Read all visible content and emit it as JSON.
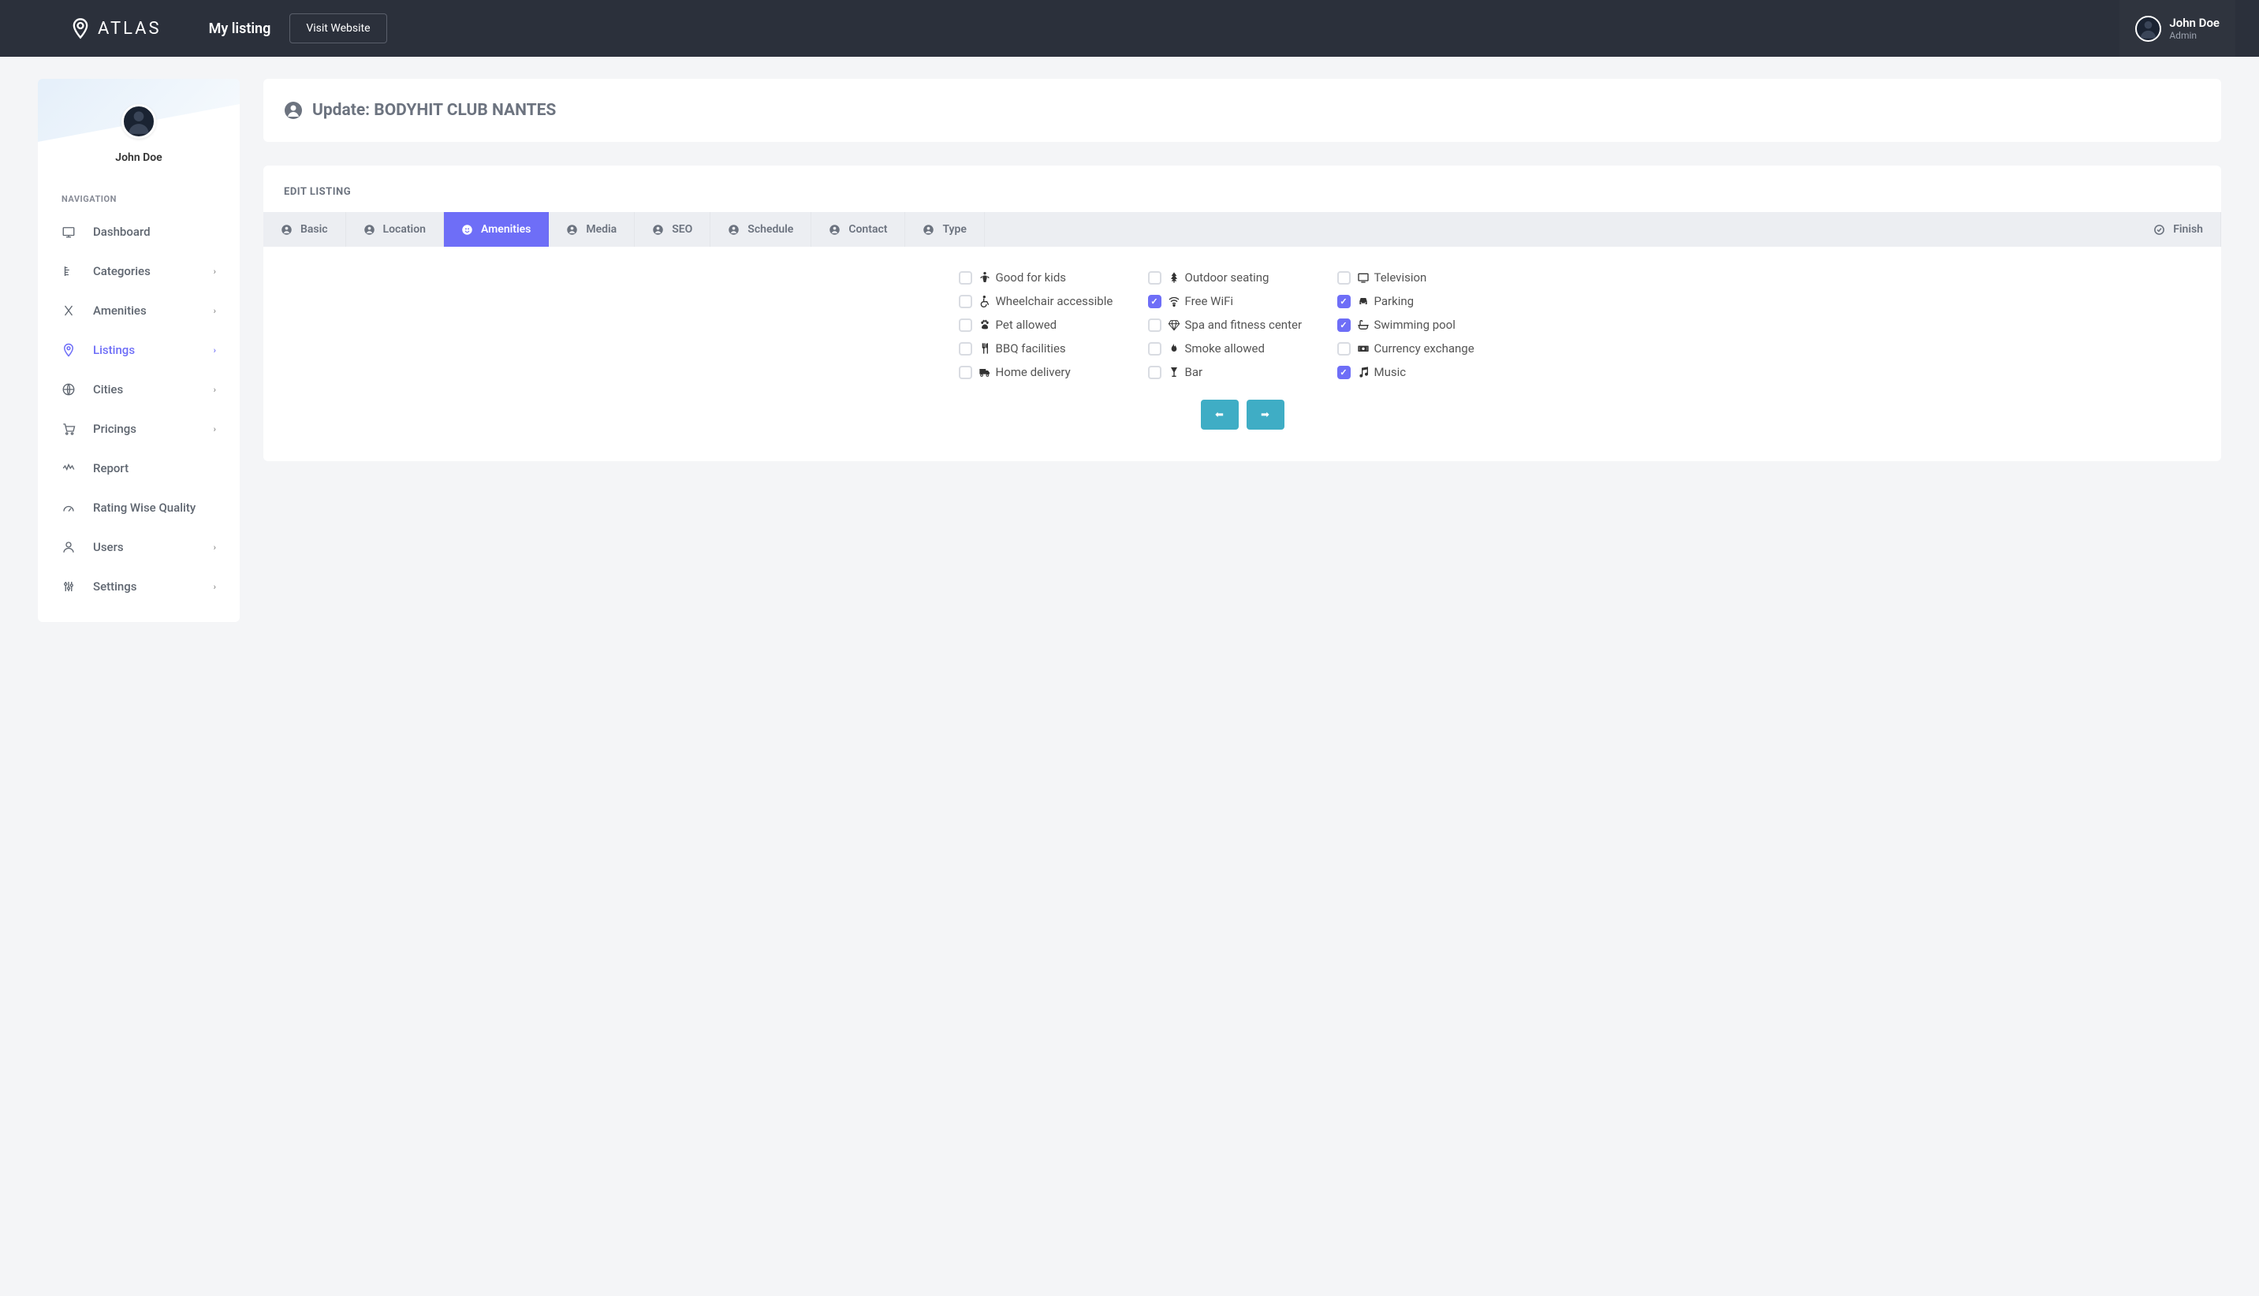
{
  "header": {
    "logo_text": "ATLAS",
    "page_title": "My listing",
    "visit_button": "Visit Website",
    "user_name": "John Doe",
    "user_role": "Admin"
  },
  "sidebar": {
    "user_name": "John Doe",
    "nav_heading": "NAVIGATION",
    "items": [
      {
        "label": "Dashboard",
        "has_children": false,
        "active": false
      },
      {
        "label": "Categories",
        "has_children": true,
        "active": false
      },
      {
        "label": "Amenities",
        "has_children": true,
        "active": false
      },
      {
        "label": "Listings",
        "has_children": true,
        "active": true
      },
      {
        "label": "Cities",
        "has_children": true,
        "active": false
      },
      {
        "label": "Pricings",
        "has_children": true,
        "active": false
      },
      {
        "label": "Report",
        "has_children": false,
        "active": false
      },
      {
        "label": "Rating Wise Quality",
        "has_children": false,
        "active": false
      },
      {
        "label": "Users",
        "has_children": true,
        "active": false
      },
      {
        "label": "Settings",
        "has_children": true,
        "active": false
      }
    ]
  },
  "main": {
    "page_title": "Update: BODYHIT CLUB NANTES",
    "edit_heading": "EDIT LISTING",
    "tabs": [
      {
        "label": "Basic",
        "active": false
      },
      {
        "label": "Location",
        "active": false
      },
      {
        "label": "Amenities",
        "active": true
      },
      {
        "label": "Media",
        "active": false
      },
      {
        "label": "SEO",
        "active": false
      },
      {
        "label": "Schedule",
        "active": false
      },
      {
        "label": "Contact",
        "active": false
      },
      {
        "label": "Type",
        "active": false
      },
      {
        "label": "Finish",
        "active": false
      }
    ],
    "amenities": [
      {
        "label": "Good for kids",
        "checked": false,
        "icon": "child"
      },
      {
        "label": "Outdoor seating",
        "checked": false,
        "icon": "tree"
      },
      {
        "label": "Television",
        "checked": false,
        "icon": "tv"
      },
      {
        "label": "Wheelchair accessible",
        "checked": false,
        "icon": "wheelchair"
      },
      {
        "label": "Free WiFi",
        "checked": true,
        "icon": "wifi"
      },
      {
        "label": "Parking",
        "checked": true,
        "icon": "car"
      },
      {
        "label": "Pet allowed",
        "checked": false,
        "icon": "paw"
      },
      {
        "label": "Spa and fitness center",
        "checked": false,
        "icon": "gem"
      },
      {
        "label": "Swimming pool",
        "checked": true,
        "icon": "bath"
      },
      {
        "label": "BBQ facilities",
        "checked": false,
        "icon": "utensils"
      },
      {
        "label": "Smoke allowed",
        "checked": false,
        "icon": "fire"
      },
      {
        "label": "Currency exchange",
        "checked": false,
        "icon": "money"
      },
      {
        "label": "Home delivery",
        "checked": false,
        "icon": "truck"
      },
      {
        "label": "Bar",
        "checked": false,
        "icon": "glass"
      },
      {
        "label": "Music",
        "checked": true,
        "icon": "music"
      }
    ]
  }
}
